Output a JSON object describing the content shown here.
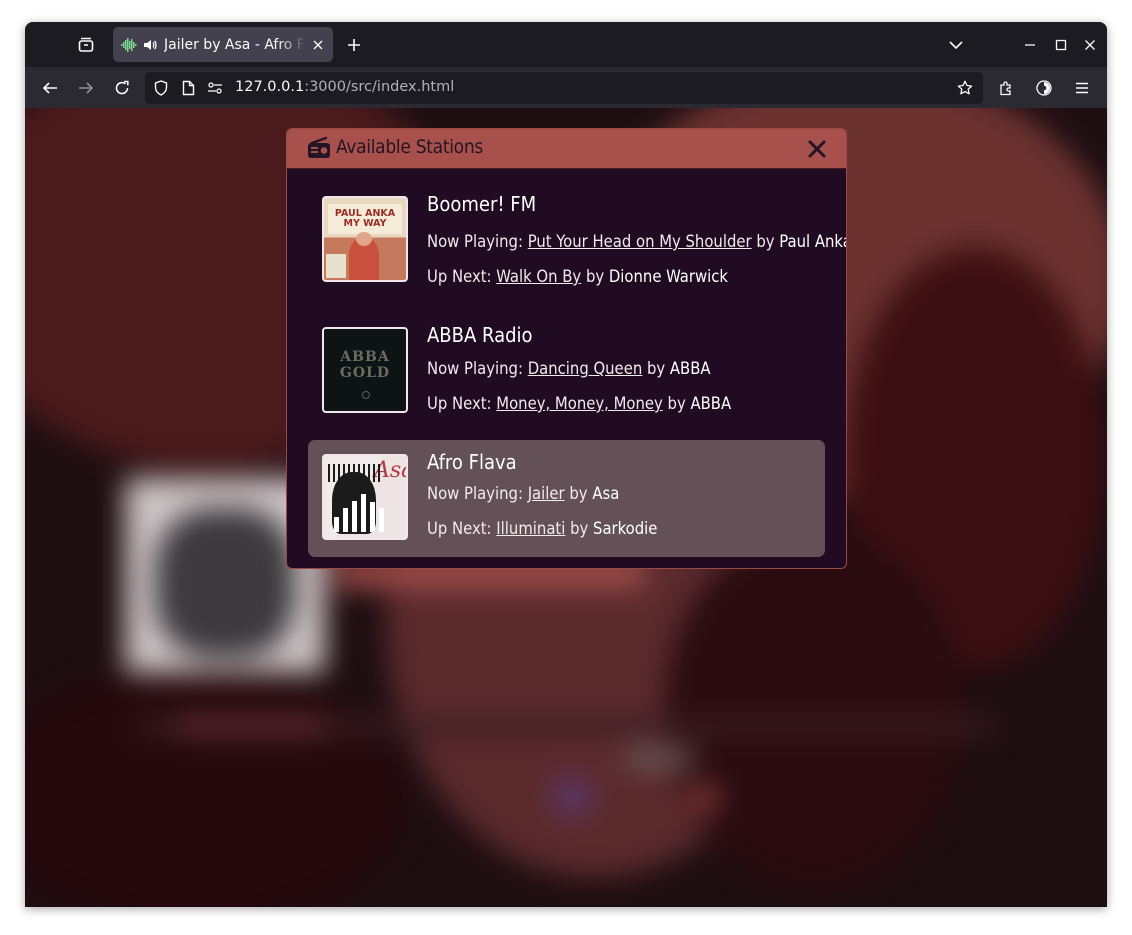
{
  "browser": {
    "tab_title": "Jailer by Asa - Afro Flava",
    "url_host": "127.0.0.1",
    "url_rest": ":3000/src/index.html"
  },
  "modal": {
    "title": "Available Stations",
    "stations": [
      {
        "name": "Boomer! FM",
        "now_label": "Now Playing:",
        "now_song": "Put Your Head on My Shoulder",
        "now_by": "by",
        "now_artist": "Paul Anka",
        "next_label": "Up Next:",
        "next_song": "Walk On By",
        "next_by": "by",
        "next_artist": "Dionne Warwick",
        "art_text": "PAUL ANKA MY WAY",
        "active": false
      },
      {
        "name": "ABBA Radio",
        "now_label": "Now Playing:",
        "now_song": "Dancing Queen",
        "now_by": "by",
        "now_artist": "ABBA",
        "next_label": "Up Next:",
        "next_song": "Money, Money, Money",
        "next_by": "by",
        "next_artist": "ABBA",
        "art_text": "ABBA GOLD",
        "active": false
      },
      {
        "name": "Afro Flava",
        "now_label": "Now Playing:",
        "now_song": "Jailer",
        "now_by": "by",
        "now_artist": "Asa",
        "next_label": "Up Next:",
        "next_song": "Illuminati",
        "next_by": "by",
        "next_artist": "Sarkodie",
        "art_text": "Asa",
        "active": true,
        "equalizer_levels": [
          0.4,
          0.62,
          0.82,
          1.0,
          0.78,
          0.62
        ]
      }
    ]
  },
  "colors": {
    "header": "#a8504b",
    "modal_bg": "#200b22",
    "active_row": "#635157"
  },
  "icons": [
    "collections-icon",
    "speaker-icon",
    "close-icon",
    "plus-icon",
    "chevron-down-icon",
    "minimize-icon",
    "maximize-icon",
    "back-icon",
    "forward-icon",
    "reload-icon",
    "shield-icon",
    "page-icon",
    "permissions-icon",
    "star-icon",
    "extensions-icon",
    "account-icon",
    "menu-icon",
    "radio-icon"
  ]
}
